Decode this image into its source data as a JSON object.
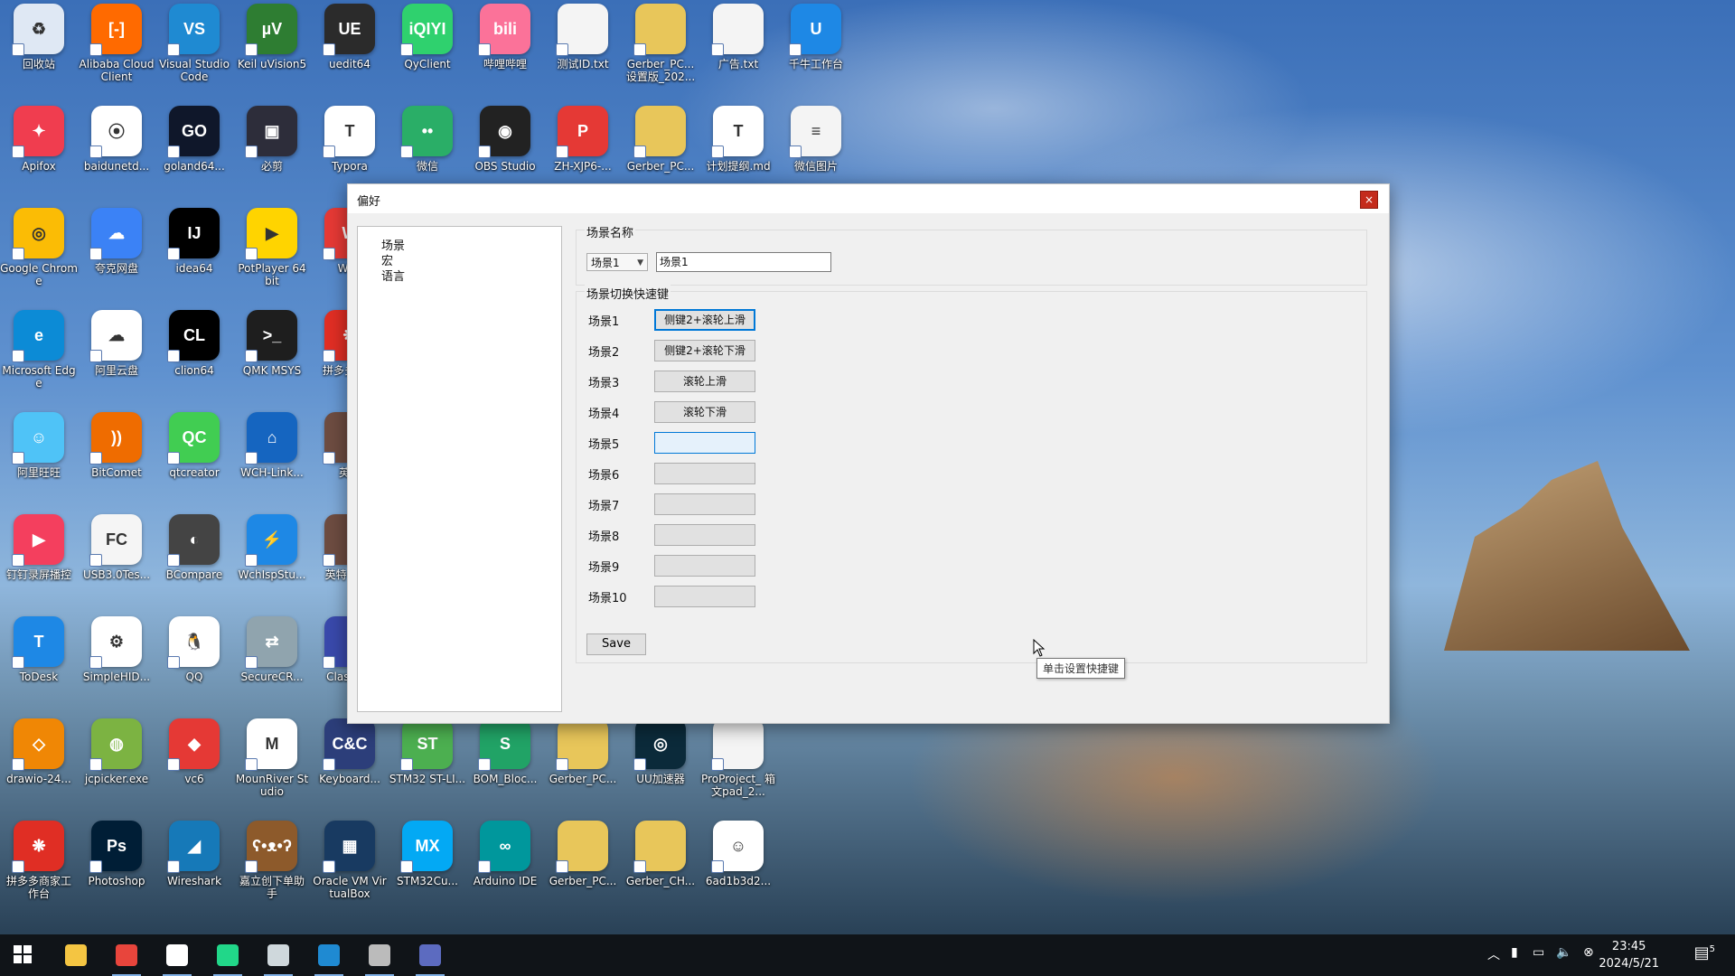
{
  "desktop": {
    "icons": [
      {
        "label": "回收站",
        "glyph": "♻",
        "color": "#dfe8f4"
      },
      {
        "label": "Alibaba Cloud Client",
        "glyph": "[-]",
        "color": "#ff6a00"
      },
      {
        "label": "Visual Studio Code",
        "glyph": "VS",
        "color": "#1f8ad2"
      },
      {
        "label": "Keil uVision5",
        "glyph": "µV",
        "color": "#2e7d32"
      },
      {
        "label": "uedit64",
        "glyph": "UE",
        "color": "#2b2b2b"
      },
      {
        "label": "QyClient",
        "glyph": "iQIYI",
        "color": "#2fd16e"
      },
      {
        "label": "哔哩哔哩",
        "glyph": "bili",
        "color": "#fb7299"
      },
      {
        "label": "测试ID.txt",
        "glyph": "",
        "color": "#f4f4f4"
      },
      {
        "label": "Gerber_PC... 设置版_202...",
        "glyph": "",
        "color": "#e8c65a"
      },
      {
        "label": "广告.txt",
        "glyph": "",
        "color": "#f4f4f4"
      },
      {
        "label": "千牛工作台",
        "glyph": "U",
        "color": "#1e88e5"
      },
      {
        "label": "Apifox",
        "glyph": "✦",
        "color": "#f03d4f"
      },
      {
        "label": "baidunetd...",
        "glyph": "⦿",
        "color": "#ffffff"
      },
      {
        "label": "goland64...",
        "glyph": "GO",
        "color": "#0f172a"
      },
      {
        "label": "必剪",
        "glyph": "▣",
        "color": "#2d2d3a"
      },
      {
        "label": "Typora",
        "glyph": "T",
        "color": "#ffffff"
      },
      {
        "label": "微信",
        "glyph": "••",
        "color": "#2aae67"
      },
      {
        "label": "OBS Studio",
        "glyph": "◉",
        "color": "#222222"
      },
      {
        "label": "ZH-XJP6-...",
        "glyph": "P",
        "color": "#e53935"
      },
      {
        "label": "Gerber_PC...",
        "glyph": "",
        "color": "#e8c65a"
      },
      {
        "label": "计划提纲.md",
        "glyph": "T",
        "color": "#ffffff"
      },
      {
        "label": "微信图片",
        "glyph": "≡",
        "color": "#f4f4f4"
      },
      {
        "label": "Google Chrome",
        "glyph": "◎",
        "color": "#fbbc05"
      },
      {
        "label": "夸克网盘",
        "glyph": "☁",
        "color": "#3b82f6"
      },
      {
        "label": "idea64",
        "glyph": "IJ",
        "color": "#000000"
      },
      {
        "label": "PotPlayer 64 bit",
        "glyph": "▶",
        "color": "#ffd400"
      },
      {
        "label": "WPS",
        "glyph": "W",
        "color": "#e53935"
      },
      {
        "label": "Microsoft Edge",
        "glyph": "e",
        "color": "#0c8bd6"
      },
      {
        "label": "阿里云盘",
        "glyph": "☁",
        "color": "#ffffff"
      },
      {
        "label": "clion64",
        "glyph": "CL",
        "color": "#000000"
      },
      {
        "label": "QMK MSYS",
        "glyph": ">_",
        "color": "#1e1e1e"
      },
      {
        "label": "拼多多商家",
        "glyph": "❋",
        "color": "#e02e24"
      },
      {
        "label": "阿里旺旺",
        "glyph": "☺",
        "color": "#4fc3f7"
      },
      {
        "label": "BitComet",
        "glyph": "))",
        "color": "#ef6c00"
      },
      {
        "label": "qtcreator",
        "glyph": "QC",
        "color": "#41cd52"
      },
      {
        "label": "WCH-Link...",
        "glyph": "⌂",
        "color": "#1565c0"
      },
      {
        "label": "英特",
        "glyph": "",
        "color": "#6d4c41"
      },
      {
        "label": "钉钉录屏播控",
        "glyph": "▶",
        "color": "#f43f5e"
      },
      {
        "label": "USB3.0Tes...",
        "glyph": "FC",
        "color": "#f5f5f5"
      },
      {
        "label": "BCompare",
        "glyph": "◐",
        "color": "#444444"
      },
      {
        "label": "WchIspStu...",
        "glyph": "⚡",
        "color": "#1e88e5"
      },
      {
        "label": "英特 WeC",
        "glyph": "",
        "color": "#6d4c41"
      },
      {
        "label": "ToDesk",
        "glyph": "T",
        "color": "#1e88e5"
      },
      {
        "label": "SimpleHID...",
        "glyph": "⚙",
        "color": "#ffffff"
      },
      {
        "label": "QQ",
        "glyph": "🐧",
        "color": "#ffffff"
      },
      {
        "label": "SecureCR...",
        "glyph": "⇄",
        "color": "#90a4ae"
      },
      {
        "label": "Clas Win",
        "glyph": "",
        "color": "#3949ab"
      },
      {
        "label": "drawio-24...",
        "glyph": "◇",
        "color": "#f08705"
      },
      {
        "label": "jcpicker.exe",
        "glyph": "◍",
        "color": "#7cb342"
      },
      {
        "label": "vc6",
        "glyph": "◆",
        "color": "#e53935"
      },
      {
        "label": "MounRiver Studio",
        "glyph": "M",
        "color": "#ffffff"
      },
      {
        "label": "Keyboard...",
        "glyph": "C&C",
        "color": "#2c3e7a"
      },
      {
        "label": "STM32 ST-LI...",
        "glyph": "ST",
        "color": "#4caf50"
      },
      {
        "label": "BOM_Bloc...",
        "glyph": "S",
        "color": "#21a366"
      },
      {
        "label": "Gerber_PC...",
        "glyph": "",
        "color": "#e8c65a"
      },
      {
        "label": "UU加速器",
        "glyph": "◎",
        "color": "#0b2a3a"
      },
      {
        "label": "ProProject_ 箱文pad_2...",
        "glyph": "",
        "color": "#f4f4f4"
      },
      {
        "label": "拼多多商家工 作台",
        "glyph": "❋",
        "color": "#e02e24"
      },
      {
        "label": "Photoshop",
        "glyph": "Ps",
        "color": "#001e36"
      },
      {
        "label": "Wireshark",
        "glyph": "◢",
        "color": "#1679b8"
      },
      {
        "label": "嘉立创下单助 手",
        "glyph": "ʕ•ᴥ•ʔ",
        "color": "#8d5a2b"
      },
      {
        "label": "Oracle VM VirtualBox",
        "glyph": "▦",
        "color": "#183a61"
      },
      {
        "label": "STM32Cu...",
        "glyph": "MX",
        "color": "#03a9f4"
      },
      {
        "label": "Arduino IDE",
        "glyph": "∞",
        "color": "#00979c"
      },
      {
        "label": "Gerber_PC...",
        "glyph": "",
        "color": "#e8c65a"
      },
      {
        "label": "Gerber_CH...",
        "glyph": "",
        "color": "#e8c65a"
      },
      {
        "label": "6ad1b3d2...",
        "glyph": "☺",
        "color": "#ffffff"
      }
    ]
  },
  "dialog": {
    "title": "偏好",
    "close_label": "×",
    "tree": [
      "场景",
      "宏",
      "语言"
    ],
    "scene_name_group": "场景名称",
    "scene_select": "场景1",
    "scene_name_value": "场景1",
    "hotkey_group": "场景切换快速键",
    "rows": [
      {
        "label": "场景1",
        "key": "侧键2+滚轮上滑",
        "state": "focus"
      },
      {
        "label": "场景2",
        "key": "侧键2+滚轮下滑",
        "state": "normal"
      },
      {
        "label": "场景3",
        "key": "滚轮上滑",
        "state": "normal"
      },
      {
        "label": "场景4",
        "key": "滚轮下滑",
        "state": "normal"
      },
      {
        "label": "场景5",
        "key": "",
        "state": "hover"
      },
      {
        "label": "场景6",
        "key": "",
        "state": "normal"
      },
      {
        "label": "场景7",
        "key": "",
        "state": "normal"
      },
      {
        "label": "场景8",
        "key": "",
        "state": "normal"
      },
      {
        "label": "场景9",
        "key": "",
        "state": "normal"
      },
      {
        "label": "场景10",
        "key": "",
        "state": "normal"
      }
    ],
    "tooltip": "单击设置快捷键",
    "save_label": "Save"
  },
  "taskbar": {
    "apps": [
      {
        "name": "windows-start-icon",
        "color": "#ffffff"
      },
      {
        "name": "file-explorer-icon",
        "color": "#f4c542"
      },
      {
        "name": "chrome-icon",
        "color": "#e8453c"
      },
      {
        "name": "mounriver-icon",
        "color": "#ffffff"
      },
      {
        "name": "clion-icon",
        "color": "#21d789"
      },
      {
        "name": "notepad-icon",
        "color": "#cfd8dc"
      },
      {
        "name": "vscode-icon",
        "color": "#1f8ad2"
      },
      {
        "name": "obs-icon",
        "color": "#bbbbbb"
      },
      {
        "name": "app-window-icon",
        "color": "#5c6bc0"
      }
    ],
    "time": "23:45",
    "date": "2024/5/21",
    "notification_count": "5"
  }
}
